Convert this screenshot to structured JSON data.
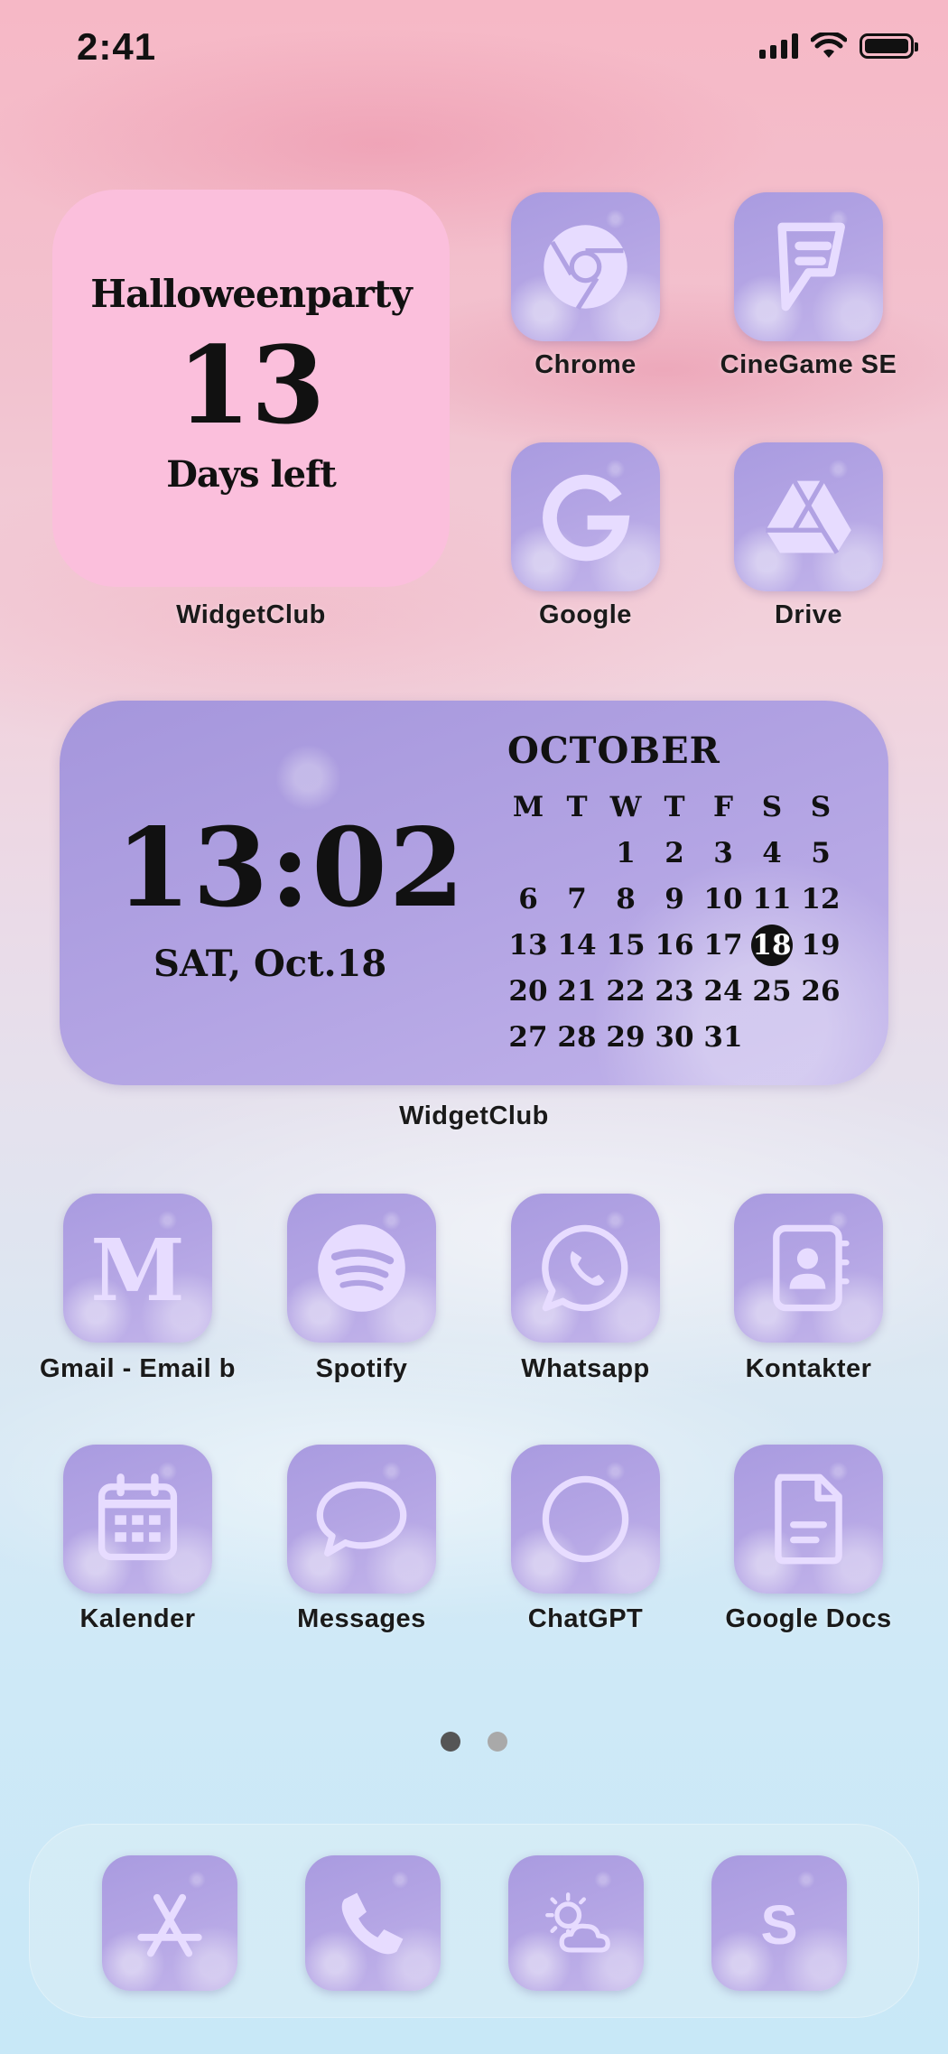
{
  "status_bar": {
    "time": "2:41"
  },
  "countdown_widget": {
    "event": "Halloweenparty",
    "days": "13",
    "suffix": "Days left",
    "label": "WidgetClub"
  },
  "apps_top": [
    {
      "label": "Chrome",
      "icon": "chrome-icon"
    },
    {
      "label": "CineGame SE",
      "icon": "foursquare-icon"
    },
    {
      "label": "Google",
      "icon": "google-icon"
    },
    {
      "label": "Drive",
      "icon": "drive-icon"
    }
  ],
  "calendar_widget": {
    "time": "13:02",
    "date": "SAT, Oct.18",
    "month": "OCTOBER",
    "weekdays": [
      "M",
      "T",
      "W",
      "T",
      "F",
      "S",
      "S"
    ],
    "days": [
      "",
      "",
      "1",
      "2",
      "3",
      "4",
      "5",
      "6",
      "7",
      "8",
      "9",
      "10",
      "11",
      "12",
      "13",
      "14",
      "15",
      "16",
      "17",
      "18",
      "19",
      "20",
      "21",
      "22",
      "23",
      "24",
      "25",
      "26",
      "27",
      "28",
      "29",
      "30",
      "31",
      "",
      ""
    ],
    "today": "18",
    "label": "WidgetClub"
  },
  "apps_row3": [
    {
      "label": "Gmail - Email b",
      "icon": "gmail-icon"
    },
    {
      "label": "Spotify",
      "icon": "spotify-icon"
    },
    {
      "label": "Whatsapp",
      "icon": "whatsapp-icon"
    },
    {
      "label": "Kontakter",
      "icon": "contacts-icon"
    }
  ],
  "apps_row4": [
    {
      "label": "Kalender",
      "icon": "calendar-icon"
    },
    {
      "label": "Messages",
      "icon": "messages-icon"
    },
    {
      "label": "ChatGPT",
      "icon": "chatgpt-icon"
    },
    {
      "label": "Google Docs",
      "icon": "docs-icon"
    }
  ],
  "page_dots": {
    "count": 2,
    "active": 0,
    "active_color": "#555555",
    "inactive_color": "#a9a9a9"
  },
  "dock": [
    "app-store-icon",
    "phone-icon",
    "weather-icon",
    "shazam-icon"
  ],
  "colors": {
    "icon_glyph": "#e7dcff",
    "countdown_bg": "#fbbfdc",
    "widget_bg": "#b0a2e3"
  }
}
